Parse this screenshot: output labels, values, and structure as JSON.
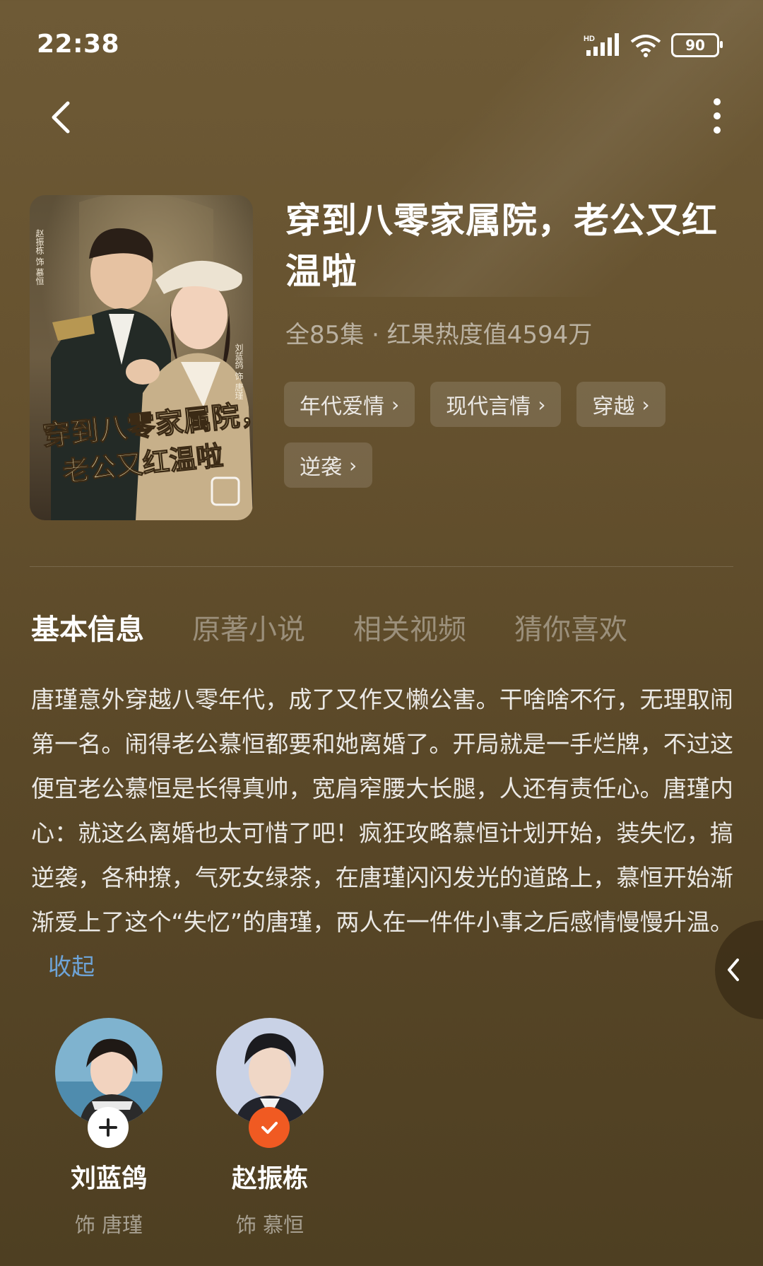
{
  "status_bar": {
    "time": "22:38",
    "network": "HD",
    "battery": "90"
  },
  "drama": {
    "title": "穿到八零家属院，老公又红温啦",
    "meta": "全85集 · 红果热度值4594万",
    "poster_text_line1": "穿到八零家属院，",
    "poster_text_line2": "老公又红温啦",
    "poster_credit_left": "赵振栋 饰 慕恒",
    "poster_credit_right": "刘蓝鸽 饰 唐瑾",
    "tags": [
      {
        "label": "年代爱情"
      },
      {
        "label": "现代言情"
      },
      {
        "label": "穿越"
      },
      {
        "label": "逆袭"
      }
    ]
  },
  "tabs": [
    {
      "label": "基本信息",
      "active": true
    },
    {
      "label": "原著小说",
      "active": false
    },
    {
      "label": "相关视频",
      "active": false
    },
    {
      "label": "猜你喜欢",
      "active": false
    }
  ],
  "description": {
    "text": "唐瑾意外穿越八零年代，成了又作又懒公害。干啥啥不行，无理取闹第一名。闹得老公慕恒都要和她离婚了。开局就是一手烂牌，不过这便宜老公慕恒是长得真帅，宽肩窄腰大长腿，人还有责任心。唐瑾内心：就这么离婚也太可惜了吧！疯狂攻略慕恒计划开始，装失忆，搞逆袭，各种撩，气死女绿茶，在唐瑾闪闪发光的道路上，慕恒开始渐渐爱上了这个“失忆”的唐瑾，两人在一件件小事之后感情慢慢升温。",
    "collapse_label": "收起"
  },
  "cast": [
    {
      "name": "刘蓝鸽",
      "role": "饰 唐瑾",
      "followed": false
    },
    {
      "name": "赵振栋",
      "role": "饰 慕恒",
      "followed": true
    }
  ],
  "colors": {
    "accent_orange": "#f05a22",
    "link_blue": "#6ea4d8"
  }
}
